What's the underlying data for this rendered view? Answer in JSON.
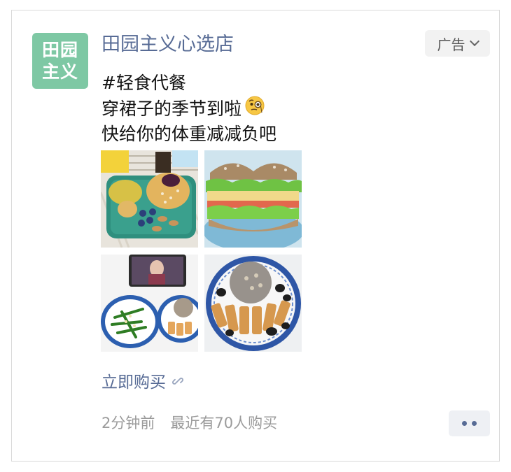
{
  "advertiser": {
    "avatar_line1": "田园",
    "avatar_line2": "主义",
    "name": "田园主义心选店",
    "avatar_color": "#7ec8a4"
  },
  "ad_badge": {
    "label": "广告"
  },
  "post": {
    "hashtag": "#轻食代餐",
    "line2": "穿裙子的季节到啦",
    "line3": "快给你的体重减减负吧",
    "emoji": "face-with-monocle-emoji"
  },
  "photos": [
    {
      "alt": "breakfast-plate-photo"
    },
    {
      "alt": "sandwich-photo"
    },
    {
      "alt": "meal-with-tablet-photo"
    },
    {
      "alt": "chicken-plate-photo"
    }
  ],
  "cta": {
    "label": "立即购买",
    "icon": "link-icon"
  },
  "meta": {
    "time": "2分钟前",
    "recent": "最近有70人购买"
  },
  "colors": {
    "link": "#576b95",
    "secondary": "#9b9b9b",
    "badge_bg": "#f2f2f2"
  }
}
